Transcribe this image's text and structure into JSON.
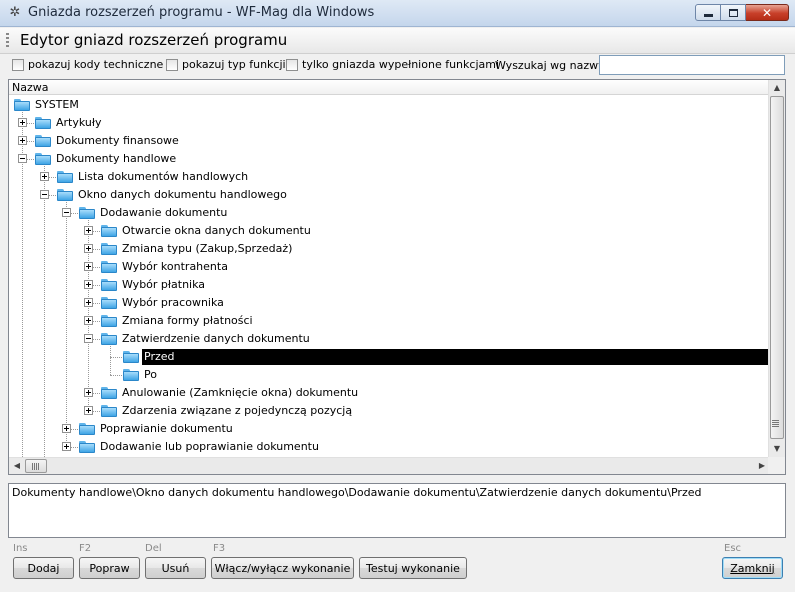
{
  "window": {
    "title": "Gniazda rozszerzeń programu - WF-Mag dla Windows",
    "close_glyph": "✕"
  },
  "header": {
    "title": "Edytor gniazd rozszerzeń programu"
  },
  "options": {
    "show_tech_codes": "pokazuj kody techniczne",
    "show_func_type": "pokazuj typ funkcji",
    "only_filled": "tylko gniazda wypełnione funkcjami",
    "search_label": "Wyszukaj wg nazwy",
    "search_value": ""
  },
  "tree": {
    "column_header": "Nazwa",
    "nodes": [
      {
        "label": "SYSTEM",
        "level": 0,
        "expander": "none"
      },
      {
        "label": "Artykuły",
        "level": 1,
        "expander": "plus"
      },
      {
        "label": "Dokumenty finansowe",
        "level": 1,
        "expander": "plus"
      },
      {
        "label": "Dokumenty handlowe",
        "level": 1,
        "expander": "minus"
      },
      {
        "label": "Lista dokumentów handlowych",
        "level": 2,
        "expander": "plus"
      },
      {
        "label": "Okno danych dokumentu handlowego",
        "level": 2,
        "expander": "minus"
      },
      {
        "label": "Dodawanie dokumentu",
        "level": 3,
        "expander": "minus"
      },
      {
        "label": "Otwarcie okna danych dokumentu",
        "level": 4,
        "expander": "plus"
      },
      {
        "label": "Zmiana typu (Zakup,Sprzedaż)",
        "level": 4,
        "expander": "plus"
      },
      {
        "label": "Wybór kontrahenta",
        "level": 4,
        "expander": "plus"
      },
      {
        "label": "Wybór płatnika",
        "level": 4,
        "expander": "plus"
      },
      {
        "label": "Wybór pracownika",
        "level": 4,
        "expander": "plus"
      },
      {
        "label": "Zmiana formy płatności",
        "level": 4,
        "expander": "plus"
      },
      {
        "label": "Zatwierdzenie danych dokumentu",
        "level": 4,
        "expander": "minus"
      },
      {
        "label": "Przed",
        "level": 5,
        "expander": "none",
        "selected": true
      },
      {
        "label": "Po",
        "level": 5,
        "expander": "none"
      },
      {
        "label": "Anulowanie (Zamknięcie okna) dokumentu",
        "level": 4,
        "expander": "plus"
      },
      {
        "label": "Zdarzenia związane z pojedynczą pozycją",
        "level": 4,
        "expander": "plus"
      },
      {
        "label": "Poprawianie dokumentu",
        "level": 3,
        "expander": "plus"
      },
      {
        "label": "Dodawanie lub poprawianie dokumentu",
        "level": 3,
        "expander": "plus"
      }
    ]
  },
  "path": "Dokumenty handlowe\\Okno danych dokumentu handlowego\\Dodawanie dokumentu\\Zatwierdzenie danych dokumentu\\Przed",
  "buttons": {
    "add": {
      "label": "Dodaj",
      "hotkey": "Ins"
    },
    "edit": {
      "label": "Popraw",
      "hotkey": "F2"
    },
    "delete": {
      "label": "Usuń",
      "hotkey": "Del"
    },
    "toggle": {
      "label": "Włącz/wyłącz wykonanie",
      "hotkey": "F3"
    },
    "test": {
      "label": "Testuj wykonanie"
    },
    "close": {
      "label": "Zamknij",
      "hotkey": "Esc"
    }
  }
}
